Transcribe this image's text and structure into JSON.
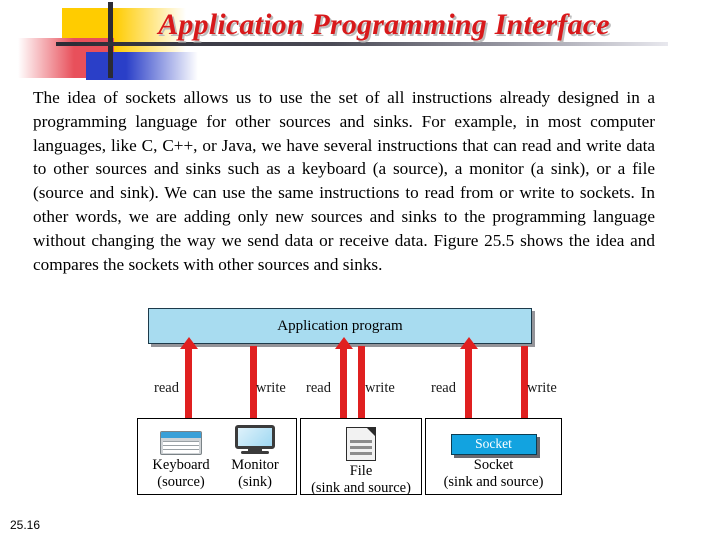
{
  "slide": {
    "title": "Application Programming Interface",
    "footer_number": "25.16",
    "title_color": "#D8191B"
  },
  "body": {
    "paragraph": "The idea of sockets allows us to use the set of all instructions already designed in a programming language for other sources and sinks. For example, in most computer languages, like C, C++, or Java, we have several instructions that can read and write data to other sources and sinks such as a keyboard (a source), a monitor (a sink), or a file (source and sink). We can use the same instructions to read from or write to sockets. In other words, we are adding only new sources and sinks to the programming language  without changing the way we send data or receive data. Figure 25.5 shows the idea and compares the sockets with other sources and sinks."
  },
  "figure": {
    "application_box": {
      "label": "Application program",
      "fill_color": "#A8DCF0",
      "border_color": "#1d3a4a"
    },
    "arrow_color": "#E02020",
    "flows": [
      {
        "label": "read",
        "direction": "up"
      },
      {
        "label": "write",
        "direction": "down"
      },
      {
        "label": "read",
        "direction": "up"
      },
      {
        "label": "write",
        "direction": "down"
      },
      {
        "label": "read",
        "direction": "up"
      },
      {
        "label": "write",
        "direction": "down"
      }
    ],
    "devices": [
      {
        "name": "keyboard-monitor-group",
        "cells": [
          {
            "icon": "keyboard-icon",
            "name": "Keyboard",
            "role": "(source)"
          },
          {
            "icon": "monitor-icon",
            "name": "Monitor",
            "role": "(sink)"
          }
        ]
      },
      {
        "name": "file-group",
        "cells": [
          {
            "icon": "file-icon",
            "name": "File",
            "role": "(sink and source)"
          }
        ]
      },
      {
        "name": "socket-group",
        "cells": [
          {
            "icon": "socket-icon",
            "chip_label": "Socket",
            "name": "Socket",
            "role": "(sink and source)",
            "chip_color": "#12A3E0"
          }
        ]
      }
    ]
  }
}
